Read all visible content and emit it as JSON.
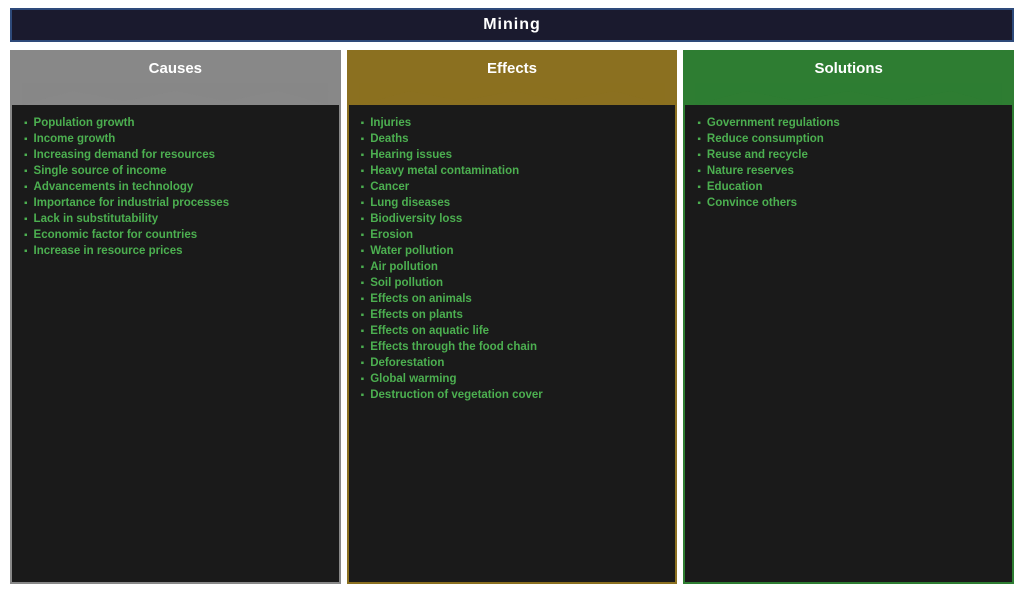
{
  "header": {
    "title": "Mining"
  },
  "columns": [
    {
      "id": "causes",
      "label": "Causes",
      "colorClass": "causes",
      "headerBg": "#888888",
      "borderColor": "#888888",
      "foldColor": "#666666",
      "items": [
        "Population growth",
        "Income growth",
        "Increasing demand for resources",
        "Single source of income",
        "Advancements in technology",
        "Importance for industrial processes",
        "Lack in substitutability",
        "Economic factor for countries",
        "Increase in resource prices"
      ]
    },
    {
      "id": "effects",
      "label": "Effects",
      "colorClass": "effects",
      "headerBg": "#8b7020",
      "borderColor": "#8b7020",
      "foldColor": "#6b5010",
      "items": [
        "Injuries",
        "Deaths",
        "Hearing issues",
        "Heavy metal contamination",
        "Cancer",
        "Lung diseases",
        "Biodiversity loss",
        "Erosion",
        "Water pollution",
        "Air pollution",
        "Soil pollution",
        "Effects on animals",
        "Effects on plants",
        "Effects on aquatic life",
        "Effects through the food chain",
        "Deforestation",
        "Global warming",
        "Destruction of vegetation cover"
      ]
    },
    {
      "id": "solutions",
      "label": "Solutions",
      "colorClass": "solutions",
      "headerBg": "#2e7d32",
      "borderColor": "#2e7d32",
      "foldColor": "#1b5e20",
      "items": [
        "Government regulations",
        "Reduce consumption",
        "Reuse and recycle",
        "Nature reserves",
        "Education",
        "Convince others"
      ]
    }
  ]
}
